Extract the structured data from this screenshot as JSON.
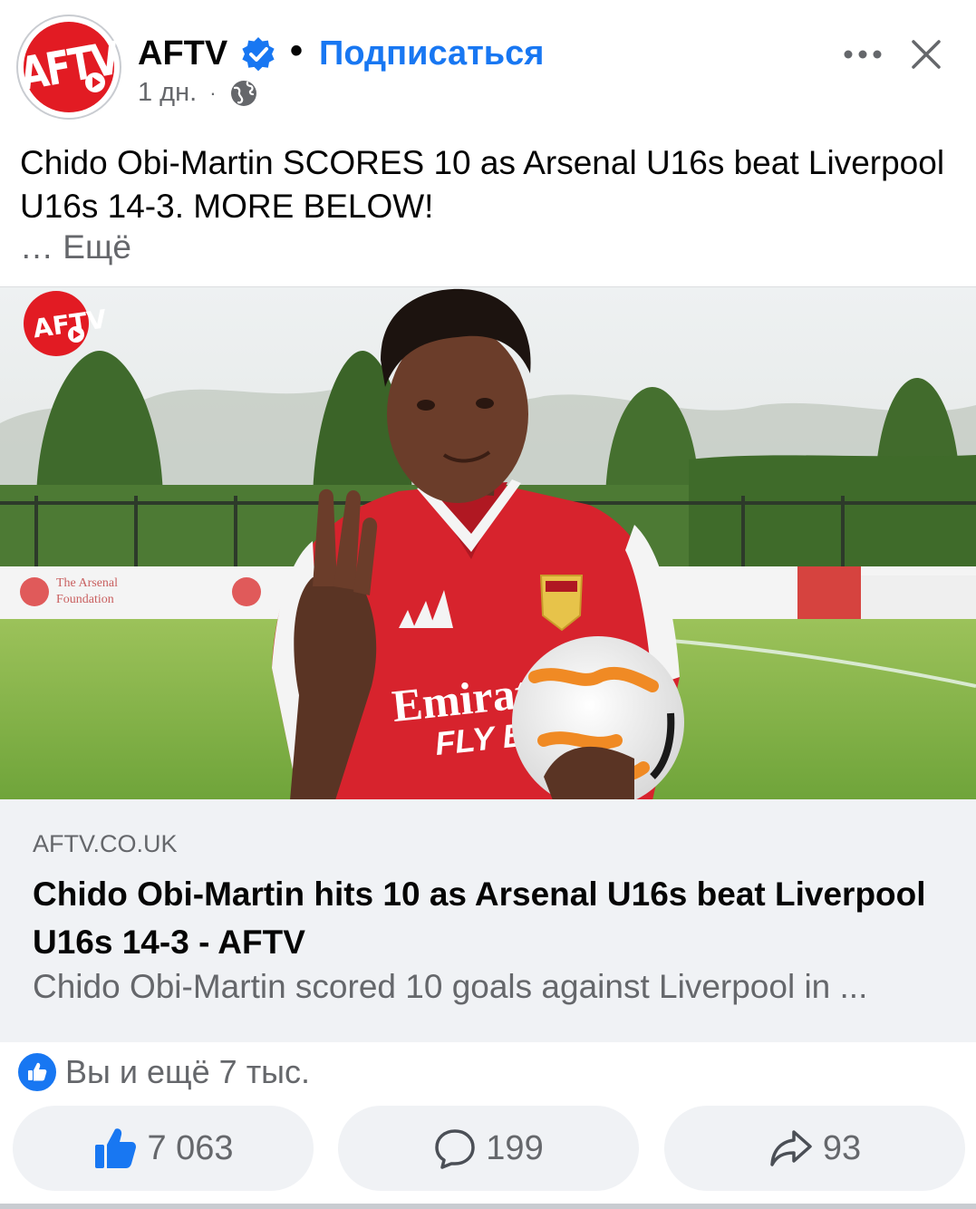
{
  "header": {
    "page_name": "AFTV",
    "logo_text": "AFTV",
    "separator_dot": "•",
    "follow_label": "Подписаться",
    "time": "1 дн.",
    "meta_separator": "·",
    "icons": {
      "verified": "verified-badge-icon",
      "privacy": "globe-icon",
      "more": "more-horizontal-icon",
      "close": "close-icon"
    }
  },
  "post": {
    "text": "Chido Obi-Martin SCORES 10 as Arsenal U16s beat Liverpool U16s 14-3. MORE BELOW!",
    "see_more": "… Ещё"
  },
  "photo": {
    "watermark_logo": "AFTV",
    "shirt_sponsor_line1": "Emirates",
    "shirt_sponsor_line2": "FLY BE",
    "board_text_line1": "The Arsenal",
    "board_text_line2": "Foundation"
  },
  "link_preview": {
    "domain": "AFTV.CO.UK",
    "title": "Chido Obi-Martin hits 10 as Arsenal U16s beat Liverpool U16s 14-3 - AFTV",
    "description": "Chido Obi-Martin scored 10 goals against Liverpool in ..."
  },
  "reactions": {
    "summary": "Вы и ещё 7 тыс.",
    "icon": "like-reaction-icon"
  },
  "actions": {
    "likes": "7 063",
    "comments": "199",
    "shares": "93"
  },
  "colors": {
    "accent": "#1877f2",
    "brand_red": "#e21b23",
    "secondary_text": "#65676b"
  }
}
